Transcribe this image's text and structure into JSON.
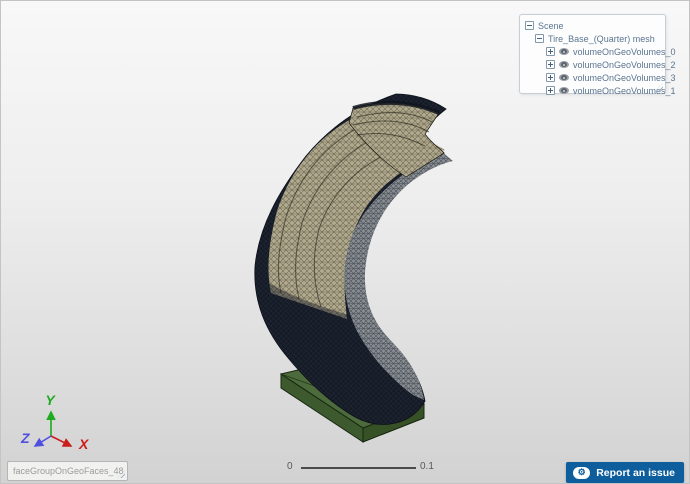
{
  "scene_tree": {
    "root_label": "Scene",
    "mesh_label": "Tire_Base_(Quarter) mesh",
    "volumes": [
      {
        "label": "volumeOnGeoVolumes_0"
      },
      {
        "label": "volumeOnGeoVolumes_2"
      },
      {
        "label": "volumeOnGeoVolumes_3"
      },
      {
        "label": "volumeOnGeoVolumes_1"
      }
    ]
  },
  "selection_label": "faceGroupOnGeoFaces_48",
  "scale_bar": {
    "min": "0",
    "max": "0.1"
  },
  "report_button": {
    "label": "Report an issue"
  },
  "axes": {
    "x": {
      "label": "X",
      "color": "#cc1d1d"
    },
    "y": {
      "label": "Y",
      "color": "#1faa1f"
    },
    "z": {
      "label": "Z",
      "color": "#5050e0"
    }
  },
  "model": {
    "name": "Tire_Base_(Quarter) mesh",
    "colors": {
      "base_top": "#4c6b3d",
      "base_front": "#3d5a2f",
      "base_right": "#365126",
      "base_edge": "#17250f",
      "tire_dark": "#151b26",
      "tire_sidewall": "#b1aa8e",
      "tire_gray_band": "#878d92",
      "ply_line": "#2a2820"
    }
  }
}
